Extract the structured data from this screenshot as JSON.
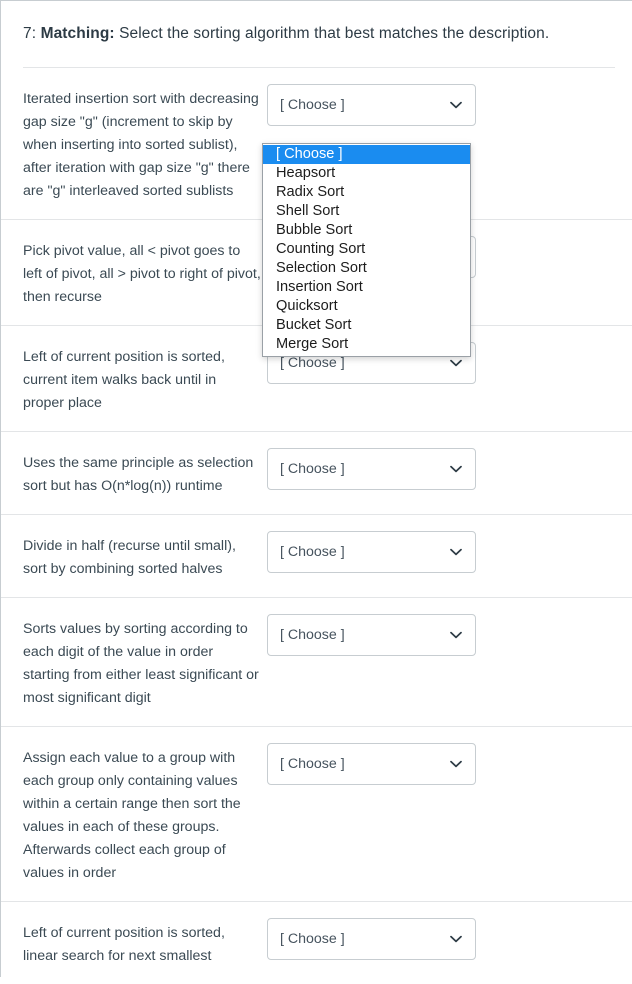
{
  "question": {
    "number": "7:",
    "label": "Matching:",
    "prompt": "Select the sorting algorithm that best matches the description."
  },
  "select": {
    "placeholder": "[ Choose ]",
    "chevron_icon": "chevron-down-icon"
  },
  "dropdown": {
    "open": true,
    "highlight_color": "#1a8cf0",
    "selected_index": 0,
    "options": [
      "[ Choose ]",
      "Heapsort",
      "Radix Sort",
      "Shell Sort",
      "Bubble Sort",
      "Counting Sort",
      "Selection Sort",
      "Insertion Sort",
      "Quicksort",
      "Bucket Sort",
      "Merge Sort"
    ]
  },
  "rows": [
    {
      "description": "Iterated insertion sort with decreasing gap size \"g\" (increment to skip by when inserting into sorted sublist), after iteration with gap size \"g\" there are \"g\" interleaved sorted sublists",
      "value": "[ Choose ]"
    },
    {
      "description": "Pick pivot value, all < pivot goes to left of pivot, all > pivot to right of pivot, then recurse",
      "value": "[ Choose ]"
    },
    {
      "description": "Left of current position is sorted, current item walks back until in proper place",
      "value": "[ Choose ]"
    },
    {
      "description": "Uses the same principle as selection sort but has O(n*log(n)) runtime",
      "value": "[ Choose ]"
    },
    {
      "description": "Divide in half (recurse until small), sort by combining sorted halves",
      "value": "[ Choose ]"
    },
    {
      "description": "Sorts values by sorting according to each digit of the value in order starting from either least significant or most significant digit",
      "value": "[ Choose ]"
    },
    {
      "description": "Assign each value to a group with each group only containing values within a certain range then sort the values in each of these groups. Afterwards collect each group of values in order",
      "value": "[ Choose ]"
    },
    {
      "description": "Left of current position is sorted, linear search for next smallest",
      "value": "[ Choose ]"
    }
  ]
}
